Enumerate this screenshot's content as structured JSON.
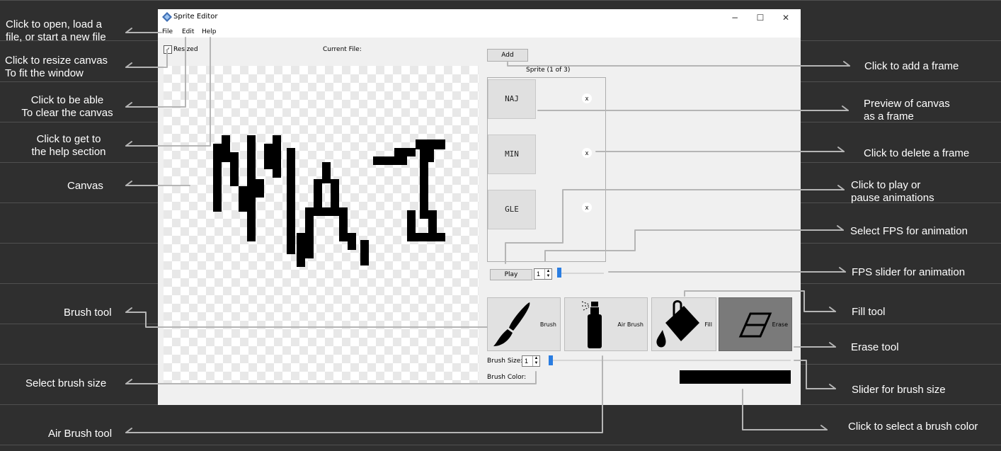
{
  "annotations": {
    "file_menu": "Click to open, load a\nfile, or start a new file",
    "resize": "Click to resize canvas\nTo fit the window",
    "edit_menu": "Click to be able\nTo clear the canvas",
    "help_menu": "Click to get to\nthe help section",
    "canvas": "Canvas",
    "brush": "Brush tool",
    "brush_size": "Select brush size",
    "air_brush": "Air Brush tool",
    "add_frame": "Click to add a frame",
    "preview": "Preview of canvas\nas a frame",
    "delete_frame": "Click to delete a frame",
    "play": "Click to play or\npause animations",
    "fps_select": "Select FPS for animation",
    "fps_slider": "FPS slider for animation",
    "fill": "Fill tool",
    "erase": "Erase tool",
    "slider_brush": "Slider for brush size",
    "brush_color": "Click  to select a brush color"
  },
  "window": {
    "title": "Sprite Editor",
    "menu": [
      "File",
      "Edit",
      "Help"
    ],
    "controls": {
      "minimize": "−",
      "maximize": "☐",
      "close": "✕"
    }
  },
  "editor": {
    "resized_label": "Resized",
    "resized_checked": true,
    "current_file_label": "Current File:",
    "add_label": "Add",
    "sprite_counter": "Sprite (1 of 3)",
    "frames": [
      {
        "thumb": "NAJ",
        "delete": "x"
      },
      {
        "thumb": "MIN",
        "delete": "x"
      },
      {
        "thumb": "GLE",
        "delete": "x"
      }
    ],
    "play_label": "Play",
    "fps_value": "1",
    "tools": [
      {
        "label": "Brush",
        "icon": "paintbrush-icon"
      },
      {
        "label": "Air Brush",
        "icon": "spray-can-icon"
      },
      {
        "label": "Fill",
        "icon": "paint-bucket-icon"
      },
      {
        "label": "Erase",
        "icon": "eraser-icon"
      }
    ],
    "brush_size_label": "Brush Size:",
    "brush_size_value": "1",
    "brush_color_label": "Brush Color:",
    "brush_color": "#000000"
  }
}
